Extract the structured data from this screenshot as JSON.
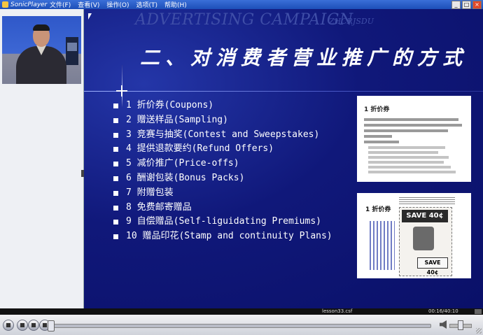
{
  "window": {
    "app_name": "SonicPlayer",
    "menu": [
      "文件(F)",
      "查看(V)",
      "操作(O)",
      "选项(T)",
      "帮助(H)"
    ],
    "controls": {
      "minimize": "_",
      "maximize": "□",
      "close": "×"
    }
  },
  "slide": {
    "watermark": "ADVERTISING CAMPAIGN",
    "watermark_sub": "ZHCRJSDU",
    "title": "二、对消费者营业推广的方式",
    "items": [
      "1 折价券(Coupons)",
      "2 赠送样品(Sampling)",
      "3 竞赛与抽奖(Contest and Sweepstakes)",
      "4 提供退款要约(Refund Offers)",
      "5 减价推广(Price-offs)",
      "6 酬谢包装(Bonus Packs)",
      "7 附赠包装",
      "8 免费邮寄赠品",
      "9 自偿赠品(Self-liguidating Premiums)",
      "10 赠品印花(Stamp and continuity Plans)"
    ],
    "doc_card_title": "1 折价券",
    "coupon_card_title": "1 折价券",
    "coupon_save_top": "SAVE 40¢",
    "coupon_save_bottom": "SAVE 40¢"
  },
  "status": {
    "filename": "lesson33.csf",
    "time": "00:16/40:10"
  },
  "icons": {
    "pause": "pause-icon",
    "stop": "stop-icon",
    "prev": "previous-icon",
    "next": "next-icon",
    "volume": "speaker-icon"
  }
}
